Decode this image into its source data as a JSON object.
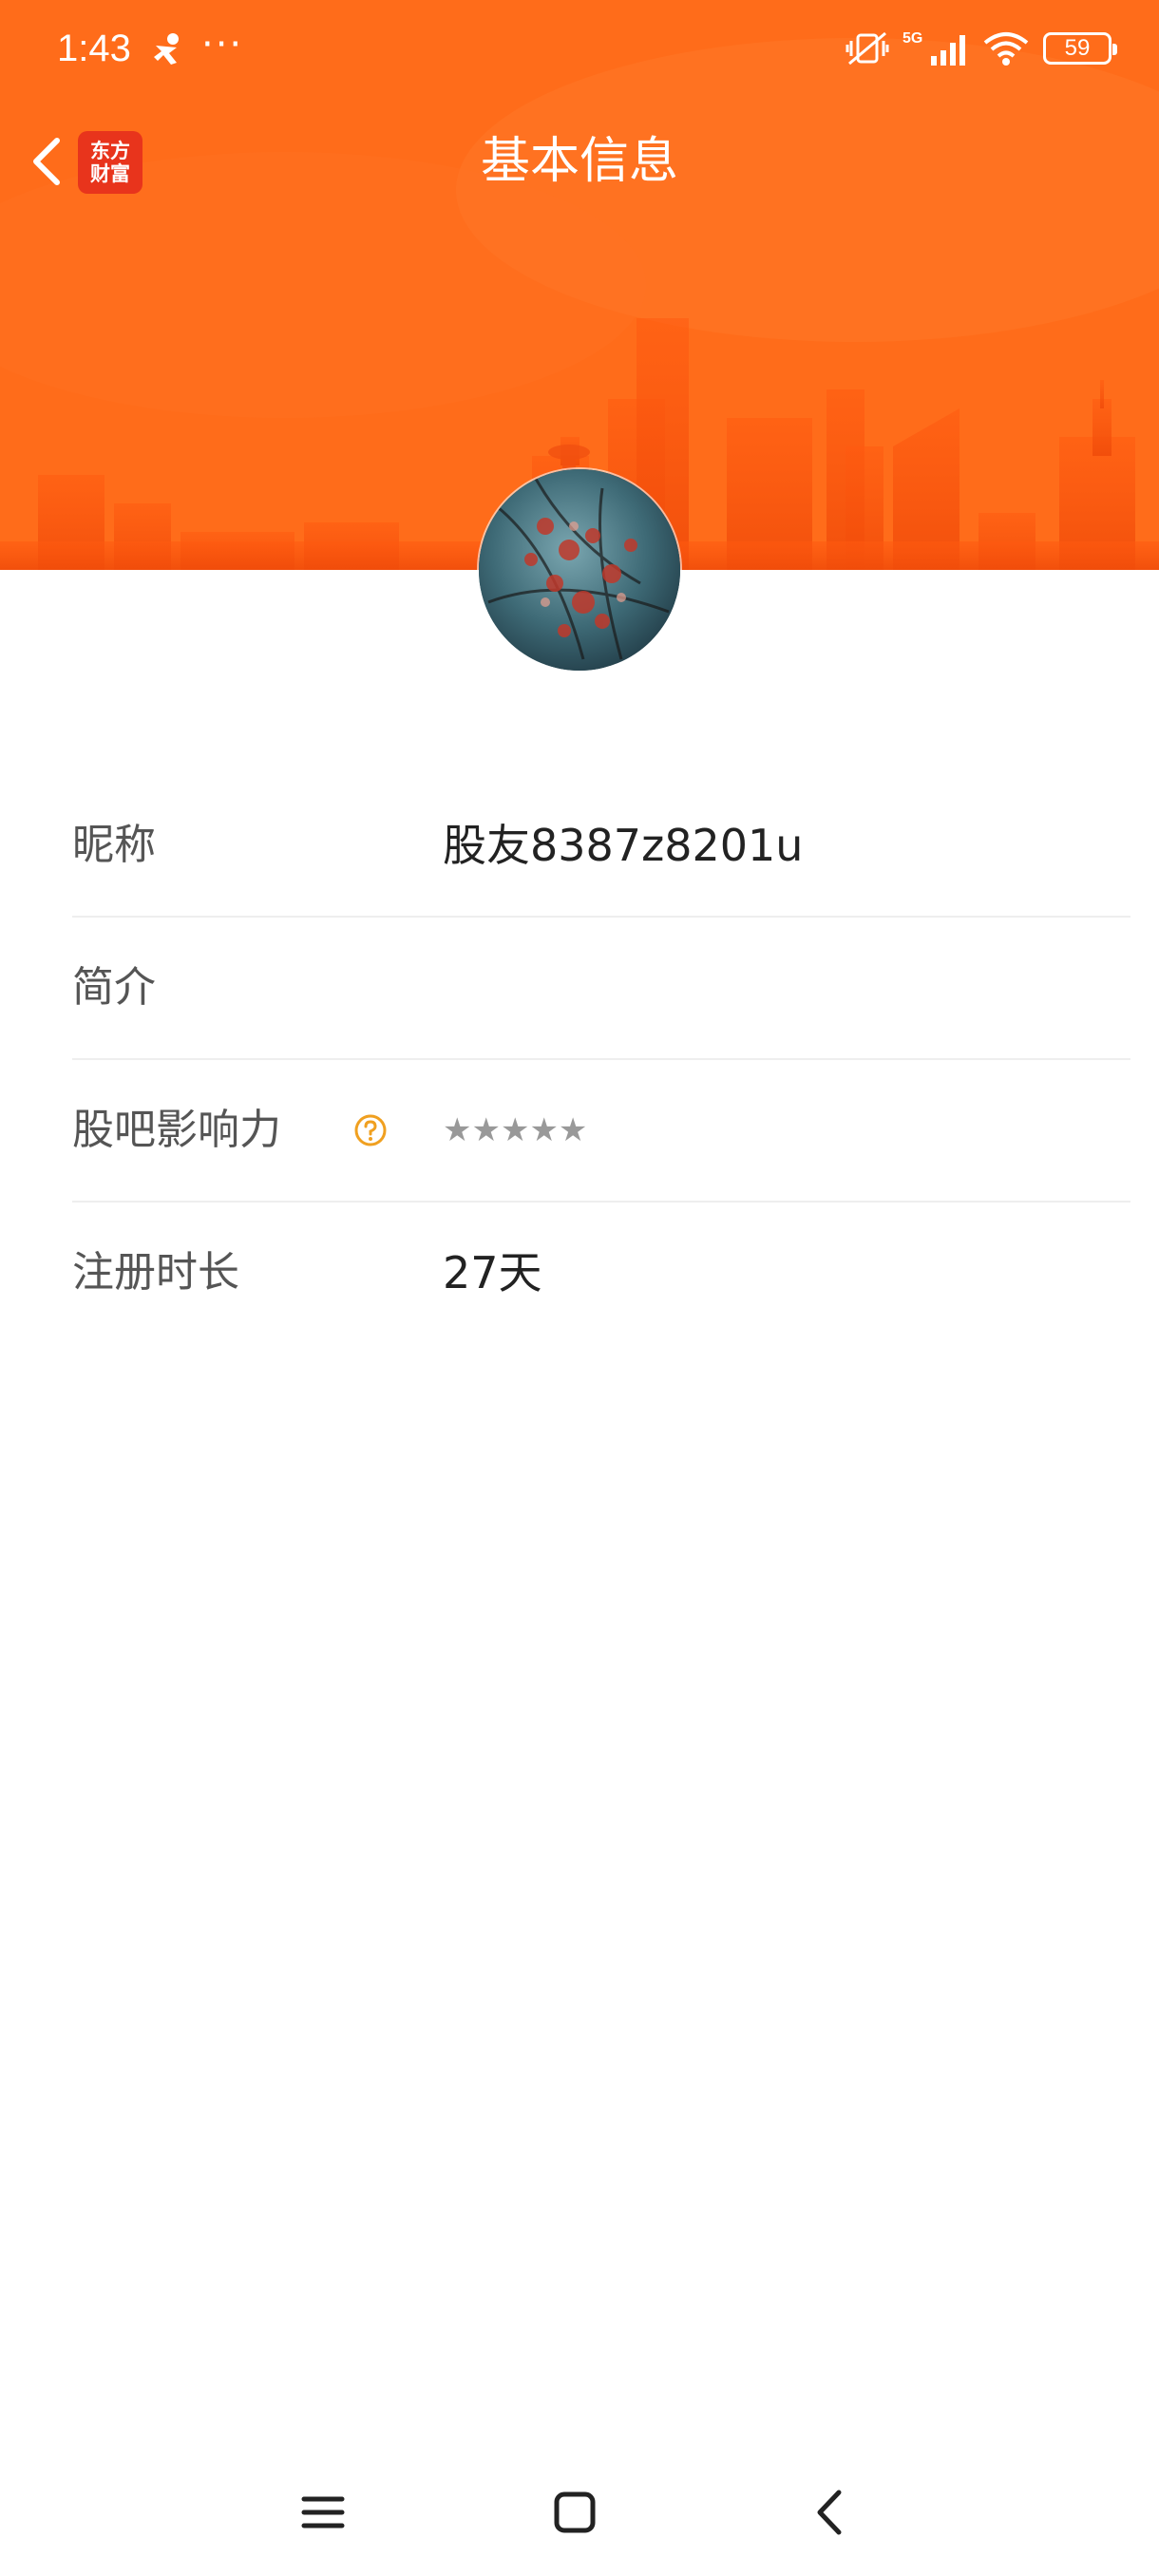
{
  "status_bar": {
    "time": "1:43",
    "more": "···",
    "network": "5G",
    "battery": "59"
  },
  "nav": {
    "title": "基本信息",
    "logo_line1": "东方",
    "logo_line2": "财富"
  },
  "colors": {
    "header_orange": "#ff6a1a",
    "logo_red": "#e8341c",
    "help_icon_orange": "#f0a020"
  },
  "profile": {
    "rows": [
      {
        "label": "昵称",
        "value": "股友8387z8201u"
      },
      {
        "label": "简介",
        "value": ""
      },
      {
        "label": "股吧影响力",
        "value": "★★★★★",
        "stars_filled": 0,
        "stars_total": 5
      },
      {
        "label": "注册时长",
        "value": "27天"
      }
    ]
  },
  "icons": {
    "back": "chevron-left-icon",
    "help": "question-circle-icon",
    "menu": "menu-icon",
    "home": "home-square-icon",
    "sys_back": "chevron-left-icon"
  }
}
